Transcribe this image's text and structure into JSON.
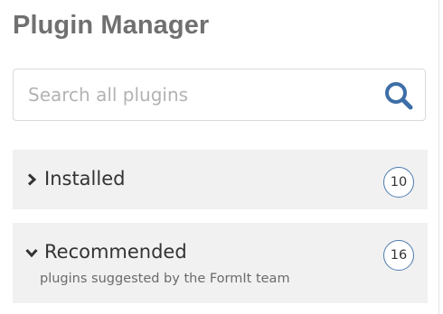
{
  "header": {
    "title": "Plugin Manager"
  },
  "search": {
    "placeholder": "Search all plugins",
    "value": "",
    "icon": "search-icon"
  },
  "sections": [
    {
      "label": "Installed",
      "count": "10",
      "expanded": false,
      "icon": "chevron-right-icon"
    },
    {
      "label": "Recommended",
      "subtitle": "plugins suggested by the FormIt team",
      "count": "16",
      "expanded": true,
      "icon": "chevron-down-icon"
    }
  ],
  "colors": {
    "title": "#707070",
    "section_bg": "#f1f1f1",
    "accent_blue": "#3d6ea7",
    "badge_border": "#4d7bb0"
  }
}
